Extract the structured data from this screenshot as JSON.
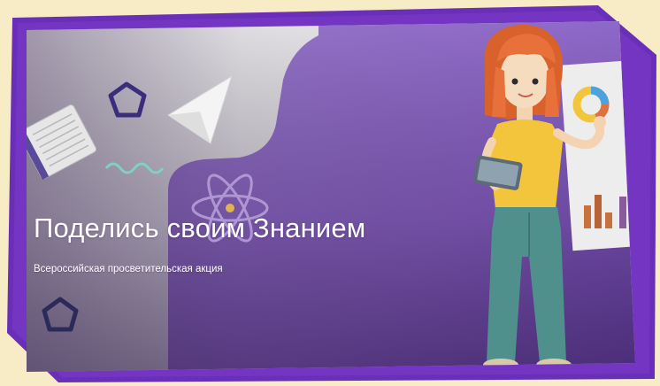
{
  "banner": {
    "title": "Поделись своим Знанием",
    "subtitle": "Всероссийская просветительская акция"
  },
  "colors": {
    "background": "#f7ecc6",
    "frame": "#6a2fb8",
    "banner_purple": "#8f67c9",
    "banner_light": "#ececec",
    "character_hair": "#e8703a",
    "character_shirt": "#f2c53d",
    "character_pants": "#4f8f8c"
  },
  "icons": [
    "pentagon-icon",
    "paper-plane-icon",
    "atom-icon",
    "notebook-icon",
    "donut-chart-icon",
    "bar-chart-icon",
    "tablet-icon"
  ]
}
